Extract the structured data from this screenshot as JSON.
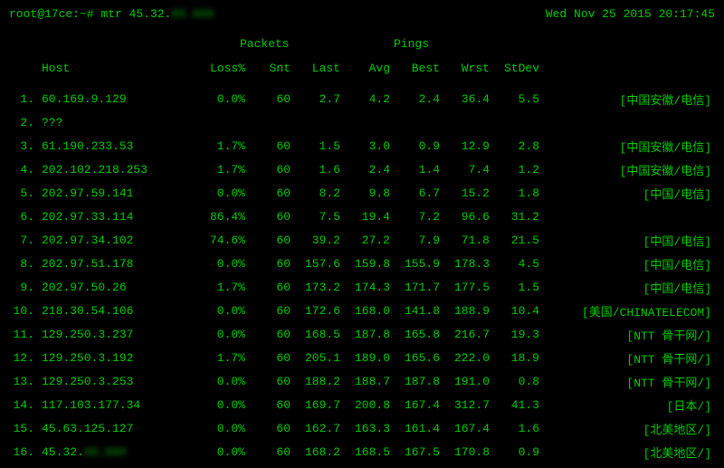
{
  "prompt": {
    "user_host": "root@17ce",
    "cwd": "~",
    "command": "mtr 45.32.",
    "masked_suffix": "XX.XXX"
  },
  "timestamp": "Wed Nov 25 2015 20:17:45",
  "group_headers": {
    "packets": "Packets",
    "pings": "Pings"
  },
  "columns": {
    "host": "Host",
    "loss": "Loss%",
    "snt": "Snt",
    "last": "Last",
    "avg": "Avg",
    "best": "Best",
    "wrst": "Wrst",
    "stdev": "StDev"
  },
  "rows": [
    {
      "idx": "1.",
      "host": "60.169.9.129",
      "loss": "0.0%",
      "snt": "60",
      "last": "2.7",
      "avg": "4.2",
      "best": "2.4",
      "wrst": "36.4",
      "stdev": "5.5",
      "loc": "[中国安徽/电信]"
    },
    {
      "idx": "2.",
      "host": "???",
      "loss": "",
      "snt": "",
      "last": "",
      "avg": "",
      "best": "",
      "wrst": "",
      "stdev": "",
      "loc": ""
    },
    {
      "idx": "3.",
      "host": "61.190.233.53",
      "loss": "1.7%",
      "snt": "60",
      "last": "1.5",
      "avg": "3.0",
      "best": "0.9",
      "wrst": "12.9",
      "stdev": "2.8",
      "loc": "[中国安徽/电信]"
    },
    {
      "idx": "4.",
      "host": "202.102.218.253",
      "loss": "1.7%",
      "snt": "60",
      "last": "1.6",
      "avg": "2.4",
      "best": "1.4",
      "wrst": "7.4",
      "stdev": "1.2",
      "loc": "[中国安徽/电信]"
    },
    {
      "idx": "5.",
      "host": "202.97.59.141",
      "loss": "0.0%",
      "snt": "60",
      "last": "8.2",
      "avg": "9.8",
      "best": "6.7",
      "wrst": "15.2",
      "stdev": "1.8",
      "loc": "[中国/电信]"
    },
    {
      "idx": "6.",
      "host": "202.97.33.114",
      "loss": "86.4%",
      "snt": "60",
      "last": "7.5",
      "avg": "19.4",
      "best": "7.2",
      "wrst": "96.6",
      "stdev": "31.2",
      "loc": ""
    },
    {
      "idx": "7.",
      "host": "202.97.34.102",
      "loss": "74.6%",
      "snt": "60",
      "last": "39.2",
      "avg": "27.2",
      "best": "7.9",
      "wrst": "71.8",
      "stdev": "21.5",
      "loc": "[中国/电信]"
    },
    {
      "idx": "8.",
      "host": "202.97.51.178",
      "loss": "0.0%",
      "snt": "60",
      "last": "157.6",
      "avg": "159.8",
      "best": "155.9",
      "wrst": "178.3",
      "stdev": "4.5",
      "loc": "[中国/电信]"
    },
    {
      "idx": "9.",
      "host": "202.97.50.26",
      "loss": "1.7%",
      "snt": "60",
      "last": "173.2",
      "avg": "174.3",
      "best": "171.7",
      "wrst": "177.5",
      "stdev": "1.5",
      "loc": "[中国/电信]"
    },
    {
      "idx": "10.",
      "host": "218.30.54.106",
      "loss": "0.0%",
      "snt": "60",
      "last": "172.6",
      "avg": "168.0",
      "best": "141.8",
      "wrst": "188.9",
      "stdev": "10.4",
      "loc": "[美国/CHINATELECOM]"
    },
    {
      "idx": "11.",
      "host": "129.250.3.237",
      "loss": "0.0%",
      "snt": "60",
      "last": "168.5",
      "avg": "187.8",
      "best": "165.8",
      "wrst": "216.7",
      "stdev": "19.3",
      "loc": "[NTT 骨干网/]"
    },
    {
      "idx": "12.",
      "host": "129.250.3.192",
      "loss": "1.7%",
      "snt": "60",
      "last": "205.1",
      "avg": "189.0",
      "best": "165.6",
      "wrst": "222.0",
      "stdev": "18.9",
      "loc": "[NTT 骨干网/]"
    },
    {
      "idx": "13.",
      "host": "129.250.3.253",
      "loss": "0.0%",
      "snt": "60",
      "last": "188.2",
      "avg": "188.7",
      "best": "187.8",
      "wrst": "191.0",
      "stdev": "0.8",
      "loc": "[NTT 骨干网/]"
    },
    {
      "idx": "14.",
      "host": "117.103.177.34",
      "loss": "0.0%",
      "snt": "60",
      "last": "169.7",
      "avg": "200.8",
      "best": "167.4",
      "wrst": "312.7",
      "stdev": "41.3",
      "loc": "[日本/]"
    },
    {
      "idx": "15.",
      "host": "45.63.125.127",
      "loss": "0.0%",
      "snt": "60",
      "last": "162.7",
      "avg": "163.3",
      "best": "161.4",
      "wrst": "167.4",
      "stdev": "1.6",
      "loc": "[北美地区/]"
    },
    {
      "idx": "16.",
      "host": "45.32.",
      "host_masked": "XX.XXX",
      "loss": "0.0%",
      "snt": "60",
      "last": "168.2",
      "avg": "168.5",
      "best": "167.5",
      "wrst": "170.8",
      "stdev": "0.9",
      "loc": "[北美地区/]"
    }
  ]
}
